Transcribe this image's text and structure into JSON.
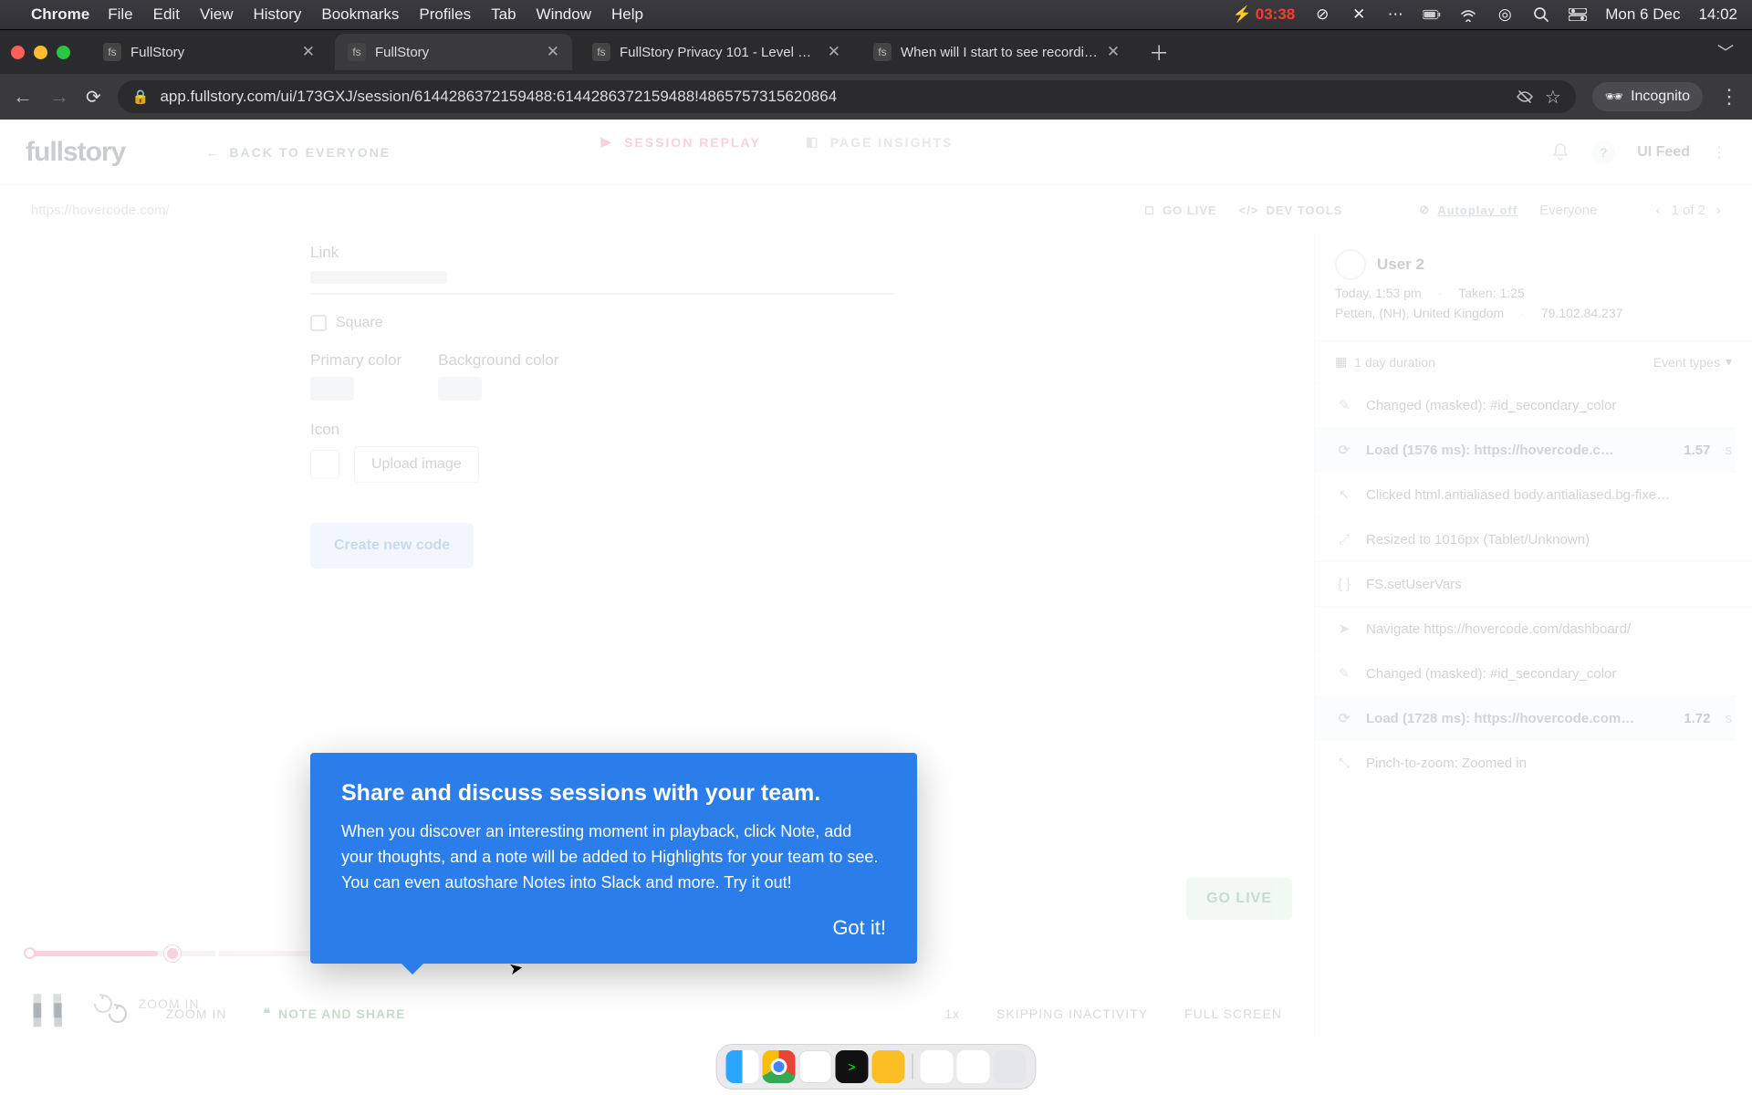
{
  "menubar": {
    "app": "Chrome",
    "items": [
      "File",
      "Edit",
      "View",
      "History",
      "Bookmarks",
      "Profiles",
      "Tab",
      "Window",
      "Help"
    ],
    "bolt_time": "03:38",
    "date": "Mon 6 Dec",
    "clock": "14:02"
  },
  "chrome": {
    "tabs": [
      {
        "title": "FullStory",
        "active": false
      },
      {
        "title": "FullStory",
        "active": true
      },
      {
        "title": "FullStory Privacy 101 - Level U…",
        "active": false
      },
      {
        "title": "When will I start to see recordi…",
        "active": false
      }
    ],
    "url": "app.fullstory.com/ui/173GXJ/session/6144286372159488:6144286372159488!4865757315620864",
    "incognito": "Incognito"
  },
  "header": {
    "back": "BACK TO EVERYONE",
    "tab_replay": "SESSION REPLAY",
    "tab_insights": "PAGE INSIGHTS",
    "ui_feed": "UI Feed"
  },
  "subbar": {
    "page_url": "https://hovercode.com/",
    "go_live": "GO LIVE",
    "dev_tools": "DEV TOOLS",
    "autoplay": "Autoplay off",
    "scope": "Everyone",
    "counter": "1 of 2"
  },
  "recorded": {
    "link_label": "Link",
    "square_label": "Square",
    "primary_label": "Primary color",
    "background_label": "Background color",
    "icon_label": "Icon",
    "upload_label": "Upload image",
    "create_label": "Create new code"
  },
  "sidebar": {
    "user": "User 2",
    "line1_a": "Today, 1:53 pm",
    "line1_b": "Taken: 1:25",
    "line2_a": "Petten, (NH), United Kingdom",
    "line2_b": "79.102.84.237",
    "email_domain": "1 day duration",
    "event_types": "Event types",
    "events": [
      {
        "icon": "edit",
        "text": "Changed (masked): #id_secondary_color",
        "strong": false
      },
      {
        "icon": "load",
        "text": "Load (1576 ms): https://hovercode.c…",
        "time": "1.57",
        "unit": "s",
        "strong": true,
        "bar": true
      },
      {
        "icon": "click",
        "text": "Clicked html.antialiased body.antialiased.bg-fixe…",
        "strong": false
      },
      {
        "icon": "arrow",
        "text": "Resized to 1016px (Tablet/Unknown)",
        "strong": false
      },
      {
        "icon": "code",
        "text": "FS.setUserVars",
        "strong": false
      },
      {
        "icon": "nav",
        "text": "Navigate https://hovercode.com/dashboard/",
        "strong": false
      },
      {
        "icon": "edit",
        "text": "Changed (masked): #id_secondary_color",
        "strong": false
      },
      {
        "icon": "load",
        "text": "Load (1728 ms): https://hovercode.com…",
        "time": "1.72",
        "unit": "s",
        "strong": true,
        "bar": true
      },
      {
        "icon": "pinch",
        "text": "Pinch-to-zoom: Zoomed in",
        "strong": false
      }
    ]
  },
  "player": {
    "pause": "⏸",
    "skip": "⟲",
    "zoom_in": "ZOOM IN",
    "speed": "1x",
    "skip_inactivity": "SKIPPING INACTIVITY",
    "full_screen": "FULL SCREEN",
    "note_share": "NOTE AND SHARE",
    "go_live": "GO LIVE"
  },
  "popover": {
    "title": "Share and discuss sessions with your team.",
    "body": "When you discover an interesting moment in playback, click Note, add your thoughts, and a note will be added to Highlights for your team to see. You can even autoshare Notes into Slack and more. Try it out!",
    "cta": "Got it!"
  }
}
